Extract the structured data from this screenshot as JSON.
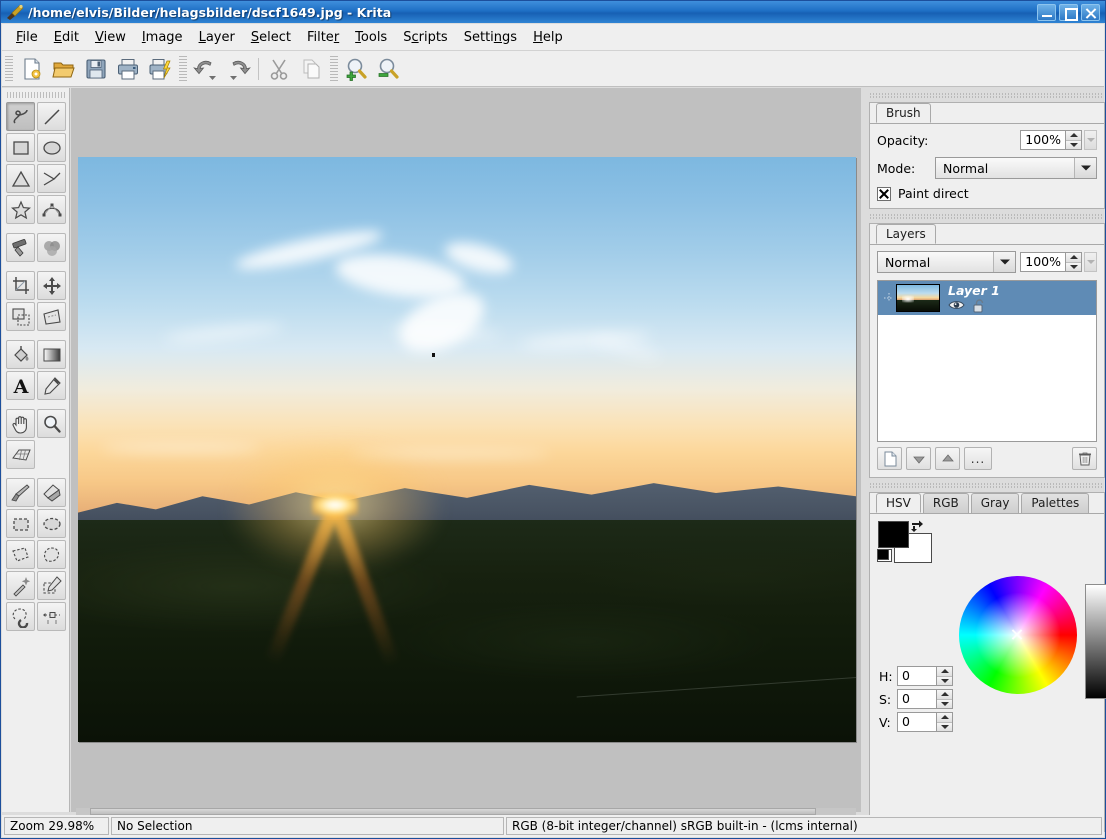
{
  "window": {
    "title": "/home/elvis/Bilder/helagsbilder/dscf1649.jpg - Krita",
    "app_icon": "krita-brush-icon",
    "controls": {
      "minimize": "_",
      "maximize": "□",
      "close": "✕"
    }
  },
  "menubar": {
    "items": [
      {
        "label": "File",
        "mnemonic": "F"
      },
      {
        "label": "Edit",
        "mnemonic": "E"
      },
      {
        "label": "View",
        "mnemonic": "V"
      },
      {
        "label": "Image",
        "mnemonic": "I"
      },
      {
        "label": "Layer",
        "mnemonic": "L"
      },
      {
        "label": "Select",
        "mnemonic": "S"
      },
      {
        "label": "Filter",
        "mnemonic": "r"
      },
      {
        "label": "Tools",
        "mnemonic": "T"
      },
      {
        "label": "Scripts",
        "mnemonic": "c"
      },
      {
        "label": "Settings",
        "mnemonic": "n"
      },
      {
        "label": "Help",
        "mnemonic": "H"
      }
    ]
  },
  "toolbar": {
    "buttons": [
      {
        "name": "new-document-button",
        "icon": "new-document-icon",
        "tooltip": "New"
      },
      {
        "name": "open-document-button",
        "icon": "open-folder-icon",
        "tooltip": "Open"
      },
      {
        "name": "save-button",
        "icon": "floppy-disk-icon",
        "tooltip": "Save"
      },
      {
        "name": "print-button",
        "icon": "printer-icon",
        "tooltip": "Print"
      },
      {
        "name": "print-preview-button",
        "icon": "printer-preview-icon",
        "tooltip": "Print Preview"
      },
      {
        "name": "undo-button",
        "icon": "undo-arrow-icon",
        "tooltip": "Undo"
      },
      {
        "name": "redo-button",
        "icon": "redo-arrow-icon",
        "tooltip": "Redo"
      },
      {
        "name": "cut-button",
        "icon": "scissors-icon",
        "tooltip": "Cut"
      },
      {
        "name": "copy-button",
        "icon": "copy-pages-icon",
        "tooltip": "Copy"
      },
      {
        "name": "zoom-in-button",
        "icon": "magnifier-plus-icon",
        "tooltip": "Zoom In"
      },
      {
        "name": "zoom-out-button",
        "icon": "magnifier-minus-icon",
        "tooltip": "Zoom Out"
      }
    ]
  },
  "toolbox": {
    "tools": [
      {
        "name": "tool-freehand-brush",
        "icon": "freehand-squiggle-icon",
        "active": true
      },
      {
        "name": "tool-line",
        "icon": "straight-line-icon",
        "active": false
      },
      {
        "name": "tool-rectangle",
        "icon": "rectangle-icon",
        "active": false
      },
      {
        "name": "tool-ellipse",
        "icon": "ellipse-icon",
        "active": false
      },
      {
        "name": "tool-polygon",
        "icon": "triangle-polygon-icon",
        "active": false
      },
      {
        "name": "tool-polyline",
        "icon": "polyline-icon",
        "active": false
      },
      {
        "name": "tool-star",
        "icon": "star-icon",
        "active": false
      },
      {
        "name": "tool-bezier-curve",
        "icon": "bezier-curve-icon",
        "active": false
      },
      {
        "name": "tool-duplicate-clone",
        "icon": "clone-stamp-icon",
        "active": false
      },
      {
        "name": "tool-smudge-blur",
        "icon": "blur-circles-icon",
        "active": false
      },
      {
        "name": "tool-crop",
        "icon": "crop-icon",
        "active": false
      },
      {
        "name": "tool-move",
        "icon": "move-cross-arrows-icon",
        "active": false
      },
      {
        "name": "tool-transform",
        "icon": "transform-squares-icon",
        "active": false
      },
      {
        "name": "tool-perspective-transform",
        "icon": "perspective-skew-icon",
        "active": false
      },
      {
        "name": "tool-fill",
        "icon": "paint-bucket-icon",
        "active": false
      },
      {
        "name": "tool-gradient",
        "icon": "gradient-swatch-icon",
        "active": false
      },
      {
        "name": "tool-text",
        "icon": "letter-a-icon",
        "active": false
      },
      {
        "name": "tool-color-picker",
        "icon": "eyedropper-icon",
        "active": false
      },
      {
        "name": "tool-pan",
        "icon": "hand-pan-icon",
        "active": false
      },
      {
        "name": "tool-zoom",
        "icon": "magnifier-icon",
        "active": false
      },
      {
        "name": "tool-perspective-grid",
        "icon": "perspective-grid-icon",
        "active": false
      },
      {
        "name": "tool-paintbrush",
        "icon": "paintbrush-icon",
        "active": false
      },
      {
        "name": "tool-eraser",
        "icon": "eraser-icon",
        "active": false
      },
      {
        "name": "tool-select-rectangular",
        "icon": "dashed-rectangle-icon",
        "active": false
      },
      {
        "name": "tool-select-elliptical",
        "icon": "dashed-ellipse-icon",
        "active": false
      },
      {
        "name": "tool-select-polygonal",
        "icon": "dashed-polygon-icon",
        "active": false
      },
      {
        "name": "tool-select-freehand",
        "icon": "lasso-icon",
        "active": false
      },
      {
        "name": "tool-select-magic-wand",
        "icon": "magic-wand-icon",
        "active": false
      },
      {
        "name": "tool-select-similar-color",
        "icon": "color-select-dropper-icon",
        "active": false
      },
      {
        "name": "tool-select-magnetic",
        "icon": "magnet-lasso-icon",
        "active": false
      },
      {
        "name": "tool-select-path",
        "icon": "path-nodes-icon",
        "active": false
      }
    ]
  },
  "canvas": {
    "image_name": "dscf1649.jpg",
    "description": "sunset-over-hills-photograph"
  },
  "brush_dock": {
    "tab": "Brush",
    "opacity_label": "Opacity:",
    "opacity_value": "100%",
    "mode_label": "Mode:",
    "mode_value": "Normal",
    "paint_direct_label": "Paint direct",
    "paint_direct_checked": true
  },
  "layers_dock": {
    "tab": "Layers",
    "blend_mode": "Normal",
    "opacity_value": "100%",
    "layers": [
      {
        "name": "Layer 1",
        "visible": true,
        "locked": false,
        "selected": true
      }
    ],
    "buttons": [
      {
        "name": "new-layer-button",
        "icon": "new-layer-page-icon"
      },
      {
        "name": "move-layer-down-button",
        "icon": "arrow-down-icon"
      },
      {
        "name": "move-layer-up-button",
        "icon": "arrow-up-icon"
      },
      {
        "name": "layer-properties-button",
        "icon": "ellipsis-icon",
        "label": "..."
      },
      {
        "name": "delete-layer-button",
        "icon": "trash-can-icon"
      }
    ]
  },
  "color_dock": {
    "tabs": [
      {
        "label": "HSV",
        "active": true
      },
      {
        "label": "RGB",
        "active": false
      },
      {
        "label": "Gray",
        "active": false
      },
      {
        "label": "Palettes",
        "active": false
      }
    ],
    "foreground_color": "#000000",
    "background_color": "#ffffff",
    "fields": [
      {
        "label": "H:",
        "value": "0",
        "name": "hue-input"
      },
      {
        "label": "S:",
        "value": "0",
        "name": "saturation-input"
      },
      {
        "label": "V:",
        "value": "0",
        "name": "value-input"
      }
    ]
  },
  "statusbar": {
    "zoom": "Zoom 29.98%",
    "selection": "No Selection",
    "colorspace": "RGB (8-bit integer/channel)  sRGB built-in - (lcms internal)"
  },
  "colors": {
    "titlebar_blue": "#1e6fc4",
    "panel_gray": "#efefef",
    "canvas_gray": "#c0c0c0",
    "layer_selected": "#5f8bb5"
  }
}
